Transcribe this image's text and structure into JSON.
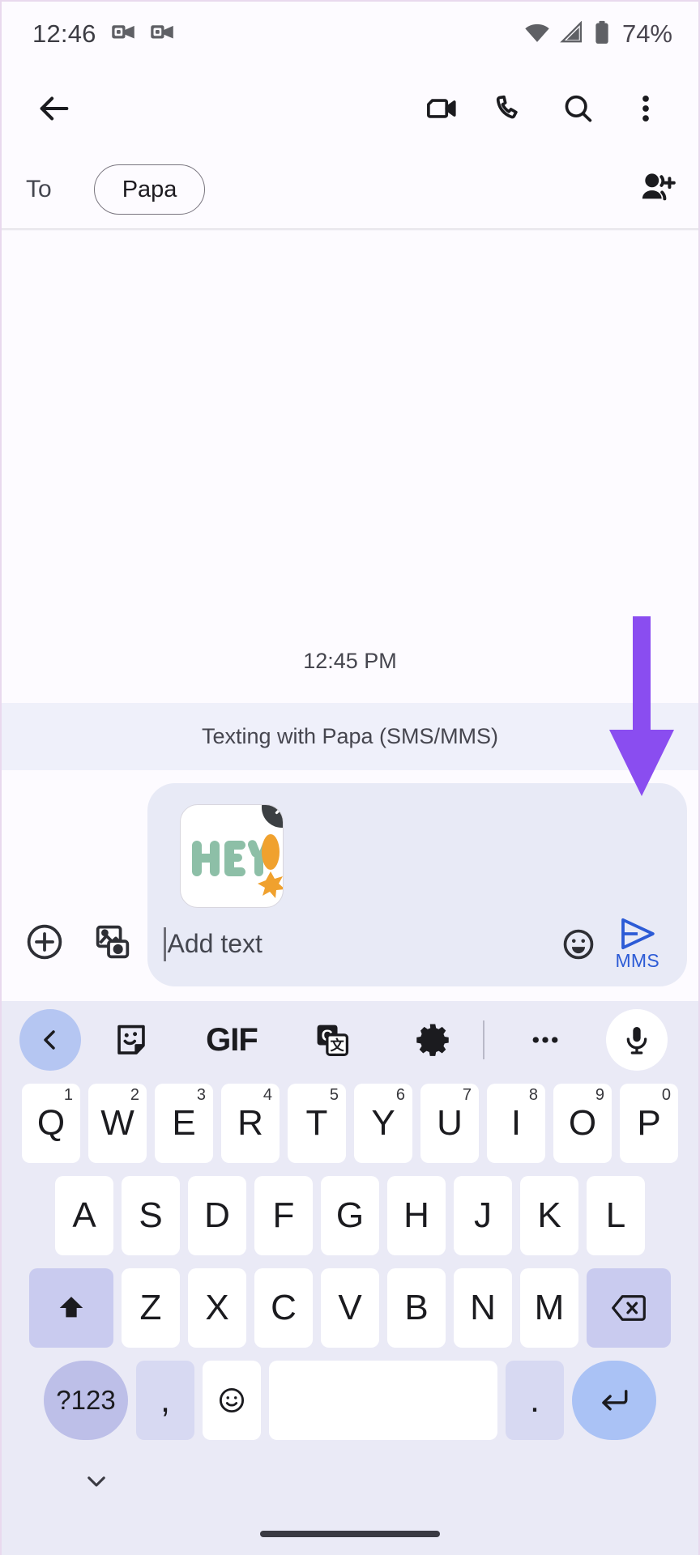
{
  "status_bar": {
    "time": "12:46",
    "notifications": [
      "outlook-icon",
      "outlook-icon"
    ],
    "wifi": "wifi-icon",
    "signal": "cellular-signal-icon",
    "battery": "battery-icon",
    "battery_percent": "74%"
  },
  "app_bar": {
    "back": "back-arrow-icon",
    "video_call": "video-call-icon",
    "voice_call": "phone-call-icon",
    "search": "search-icon",
    "overflow": "more-vertical-icon"
  },
  "recipient_row": {
    "to_label": "To",
    "chips": [
      {
        "name": "Papa"
      }
    ],
    "add_person": "add-person-icon"
  },
  "conversation": {
    "timestamp": "12:45 PM",
    "sms_banner": "Texting with Papa (SMS/MMS)"
  },
  "compose": {
    "add_attachment": "plus-circle-icon",
    "gallery": "gallery-camera-icon",
    "placeholder": "Add text",
    "emoji": "emoji-smiley-icon",
    "send_icon": "send-arrow-icon",
    "send_label": "MMS",
    "attachment": {
      "type": "sticker",
      "text": "HEY!",
      "remove": "close-icon",
      "colors": {
        "letters": "#8dbfa7",
        "accent": "#f0a12e"
      }
    },
    "annotation_arrow_color": "#8a4df0"
  },
  "keyboard": {
    "toolbar": [
      {
        "name": "back-chevron-icon",
        "label": ""
      },
      {
        "name": "sticker-icon",
        "label": ""
      },
      {
        "name": "gif-icon",
        "label": "GIF"
      },
      {
        "name": "translate-icon",
        "label": ""
      },
      {
        "name": "gear-icon",
        "label": ""
      },
      {
        "name": "divider",
        "label": ""
      },
      {
        "name": "more-horizontal-icon",
        "label": ""
      },
      {
        "name": "microphone-icon",
        "label": ""
      }
    ],
    "row1": [
      {
        "key": "Q",
        "num": "1"
      },
      {
        "key": "W",
        "num": "2"
      },
      {
        "key": "E",
        "num": "3"
      },
      {
        "key": "R",
        "num": "4"
      },
      {
        "key": "T",
        "num": "5"
      },
      {
        "key": "Y",
        "num": "6"
      },
      {
        "key": "U",
        "num": "7"
      },
      {
        "key": "I",
        "num": "8"
      },
      {
        "key": "O",
        "num": "9"
      },
      {
        "key": "P",
        "num": "0"
      }
    ],
    "row2": [
      {
        "key": "A"
      },
      {
        "key": "S"
      },
      {
        "key": "D"
      },
      {
        "key": "F"
      },
      {
        "key": "G"
      },
      {
        "key": "H"
      },
      {
        "key": "J"
      },
      {
        "key": "K"
      },
      {
        "key": "L"
      }
    ],
    "row3_shift": "shift-icon",
    "row3": [
      {
        "key": "Z"
      },
      {
        "key": "X"
      },
      {
        "key": "C"
      },
      {
        "key": "V"
      },
      {
        "key": "B"
      },
      {
        "key": "N"
      },
      {
        "key": "M"
      }
    ],
    "row3_backspace": "backspace-icon",
    "row4": {
      "symbols": "?123",
      "comma": ",",
      "emoji": "emoji-key-icon",
      "space": "",
      "period": ".",
      "enter": "enter-icon"
    },
    "hide_keyboard": "chevron-down-icon"
  }
}
